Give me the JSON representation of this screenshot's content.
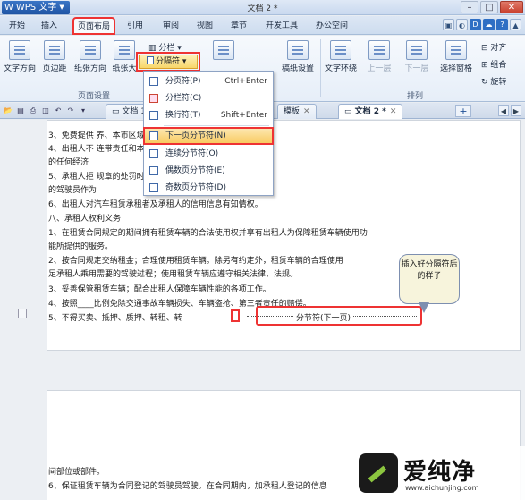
{
  "app": {
    "name": "WPS 文字",
    "doc_title": "文档 2 *"
  },
  "menu": {
    "tabs": [
      "开始",
      "插入",
      "页面布局",
      "引用",
      "审阅",
      "视图",
      "章节",
      "开发工具",
      "办公空间"
    ]
  },
  "ribbon": {
    "buttons": {
      "text_direction": "文字方向",
      "margins": "页边距",
      "orientation": "纸张方向",
      "size": "纸张大",
      "manuscript": "稿纸设置",
      "wrap": "文字环绕",
      "prev": "上一层",
      "next": "下一层",
      "selection_pane": "选择窗格",
      "align": "对齐",
      "group": "组合",
      "rotate": "旋转",
      "columns": "分栏",
      "separator": "分隔符"
    },
    "group_labels": {
      "page_setup": "页面设置",
      "arrange": "排列"
    }
  },
  "doc_tabs": {
    "tab1": "文档 1",
    "tab_mid": "模板",
    "tab2": "文档 2 *",
    "plus": "+"
  },
  "dropdown": {
    "items": [
      {
        "label": "分页符(P)",
        "shortcut": "Ctrl+Enter"
      },
      {
        "label": "分栏符(C)",
        "shortcut": ""
      },
      {
        "label": "换行符(T)",
        "shortcut": "Shift+Enter"
      },
      {
        "label": "下一页分节符(N)",
        "shortcut": ""
      },
      {
        "label": "连续分节符(O)",
        "shortcut": ""
      },
      {
        "label": "偶数页分节符(E)",
        "shortcut": ""
      },
      {
        "label": "奇数页分节符(D)",
        "shortcut": ""
      }
    ]
  },
  "document": {
    "lines": [
      "3、免费提供                                                    养、本市区域内的租赁车辆救援。",
      "4、出租人不                                              连带责任和本合同规定的风险赔付范围之外",
      "的任何经济",
      "5、承租人拒                                          规章的处罚时，出租人有权将合同中登记",
      "的驾驶员作为",
      "6、出租人对汽车租赁承租者及承租人的信用信息有知情权。",
      "八、承租人权利义务",
      "1、在租赁合同规定的期间拥有租赁车辆的合法使用权并享有出租人为保障租赁车辆使用功",
      "能所提供的服务。",
      "2、按合同规定交纳租金；合理使用租赁车辆。除另有约定外，租赁车辆的合理使用",
      "足承租人乘用需要的驾驶过程；使用租赁车辆应遵守相关法律、法规。",
      "3、妥善保管租赁车辆；配合出租人保障车辆性能的各项工作。",
      "4、按照____比例免除交通事故车辆损失、车辆盗抢、第三者责任的赔偿。",
      "5、不得买卖、抵押、质押、转租、转"
    ],
    "section_break": "分节符(下一页)",
    "callout": "插入好分隔符后的样子",
    "page2_lines": [
      "间部位或部件。",
      "6、保证租赁车辆为合同登记的驾驶员驾驶。在合同期内，加承租人登记的信息"
    ]
  },
  "watermark": {
    "name": "爱纯净",
    "url": "www.aichunjing.com"
  },
  "colors": {
    "accent": "#2f6fc4",
    "highlight": "#f8c95c",
    "annotation_red": "#e33333"
  }
}
